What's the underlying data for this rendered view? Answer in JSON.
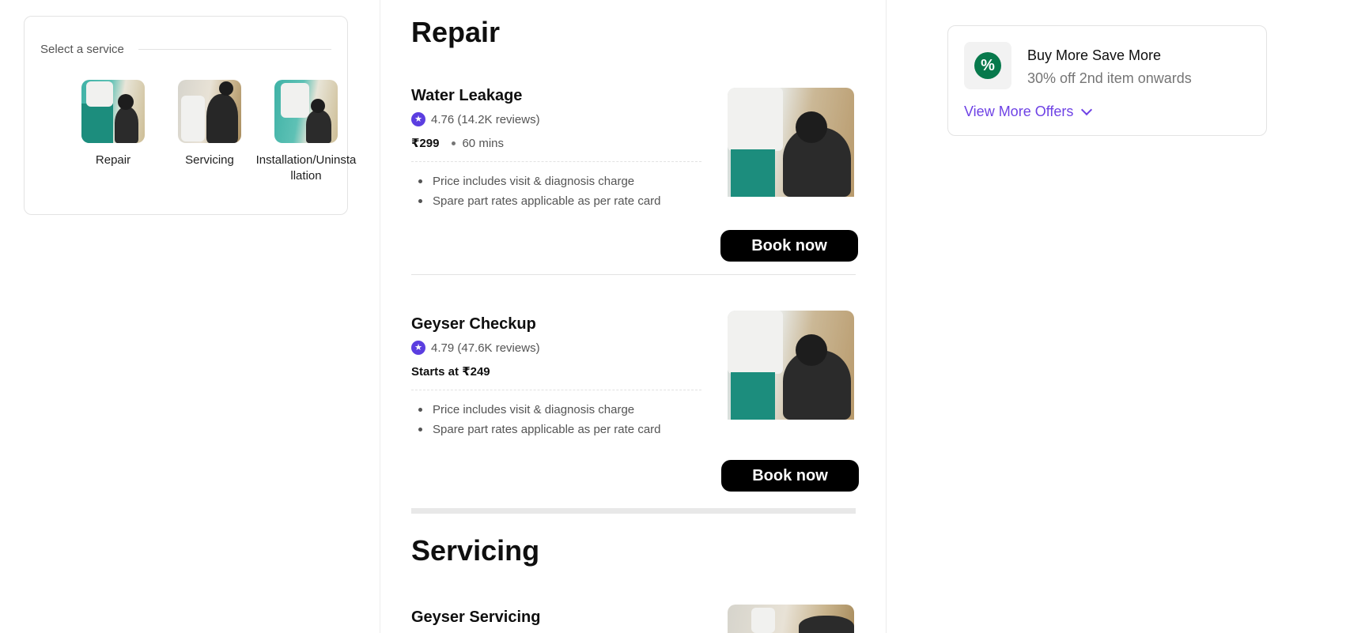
{
  "service_selector": {
    "heading": "Select a service",
    "items": [
      {
        "label": "Repair"
      },
      {
        "label": "Servicing"
      },
      {
        "label": "Installation/Uninstallation"
      }
    ]
  },
  "sections": [
    {
      "title": "Repair",
      "items": [
        {
          "name": "Water Leakage",
          "rating": "4.76 (14.2K reviews)",
          "price": "₹299",
          "duration": "60 mins",
          "bullets": [
            "Price includes visit & diagnosis charge",
            "Spare part rates applicable as per rate card"
          ],
          "cta": "Book now"
        },
        {
          "name": "Geyser Checkup",
          "rating": "4.79 (47.6K reviews)",
          "price": "Starts at ₹249",
          "bullets": [
            "Price includes visit & diagnosis charge",
            "Spare part rates applicable as per rate card"
          ],
          "cta": "Book now"
        }
      ]
    },
    {
      "title": "Servicing",
      "items": [
        {
          "name": "Geyser Servicing"
        }
      ]
    }
  ],
  "offer": {
    "icon": "percent-icon",
    "title": "Buy More Save More",
    "subtitle": "30% off 2nd item onwards",
    "link": "View More Offers"
  },
  "colors": {
    "accent": "#6e42e5",
    "star": "#5b3ee0",
    "offer_icon": "#07794c",
    "button": "#000000"
  }
}
